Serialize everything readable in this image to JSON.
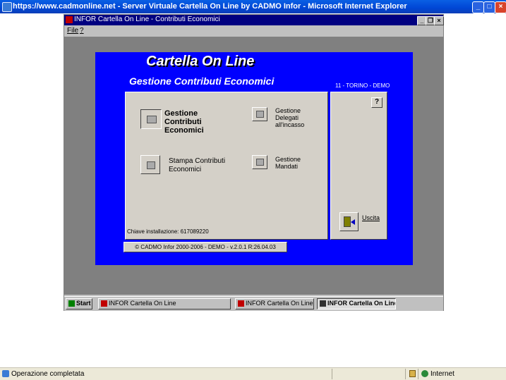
{
  "ie": {
    "title": "https://www.cadmonline.net - Server Virtuale Cartella On Line by CADMO Infor - Microsoft Internet Explorer",
    "status": "Operazione completata",
    "zone": "Internet"
  },
  "window": {
    "title": "INFOR Cartella On Line - Contributi Economici",
    "menu": [
      "File",
      "?"
    ]
  },
  "app": {
    "title": "Cartella On Line",
    "subtitle": "Gestione Contributi Economici",
    "site": "11 - TORINO - DEMO",
    "buttons": [
      {
        "line1": "Gestione",
        "line2": "Contributi",
        "line3": "Economici"
      },
      {
        "line1": "Gestione",
        "line2": "Delegati",
        "line3": "all'incasso"
      },
      {
        "line1": "Stampa Contributi",
        "line2": "Economici"
      },
      {
        "line1": "Gestione",
        "line2": "Mandati"
      }
    ],
    "install_key": "Chiave installazione: 617089220",
    "exit_label": "Uscita",
    "help_icon": "question-mark",
    "footer": "© CADMO Infor 2000-2006 - DEMO - v.2.0.1 R:26.04.03"
  },
  "taskbar": {
    "start": "Start",
    "items": [
      "INFOR Cartella On Line",
      "INFOR Cartella On Line",
      "INFOR Cartella On Line..."
    ]
  }
}
